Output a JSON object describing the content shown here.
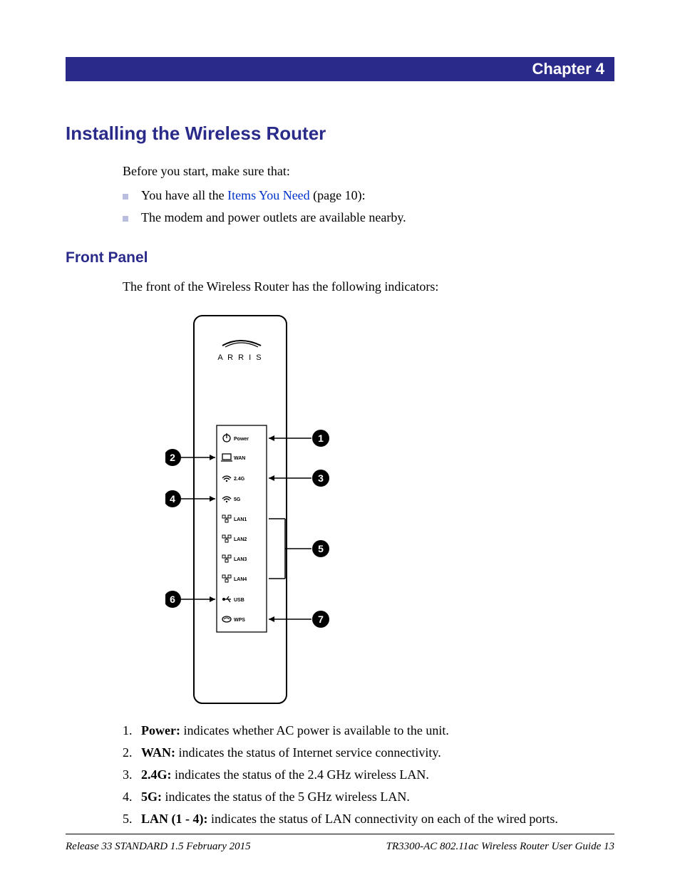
{
  "chapter": "Chapter 4",
  "title": "Installing the Wireless Router",
  "intro": "Before you start, make sure that:",
  "bullet1_a": "You have all the ",
  "bullet1_link": "Items You Need",
  "bullet1_b": " (page 10):",
  "bullet2": "The modem and power outlets are available nearby.",
  "sub_heading": "Front Panel",
  "sub_intro": "The front of the Wireless Router has the following indicators:",
  "brand": "A R R I S",
  "panel_labels": {
    "power": "Power",
    "wan": "WAN",
    "g24": "2.4G",
    "g5": "5G",
    "lan1": "LAN1",
    "lan2": "LAN2",
    "lan3": "LAN3",
    "lan4": "LAN4",
    "usb": "USB",
    "wps": "WPS"
  },
  "callouts": [
    "1",
    "2",
    "3",
    "4",
    "5",
    "6",
    "7"
  ],
  "list": [
    {
      "n": "1.",
      "label": "Power:",
      "text": " indicates whether AC power is available to the unit."
    },
    {
      "n": "2.",
      "label": "WAN:",
      "text": " indicates the status of Internet service connectivity."
    },
    {
      "n": "3.",
      "label": "2.4G:",
      "text": " indicates the status of the 2.4 GHz wireless LAN."
    },
    {
      "n": "4.",
      "label": "5G:",
      "text": " indicates the status of the 5 GHz wireless LAN."
    },
    {
      "n": "5.",
      "label": "LAN (1 - 4):",
      "text": " indicates the status of LAN connectivity on each of the wired ports."
    }
  ],
  "footer_left": "Release 33 STANDARD 1.5    February 2015",
  "footer_right_a": "TR3300-AC 802.11ac Wireless Router User Guide   ",
  "footer_right_b": "13"
}
